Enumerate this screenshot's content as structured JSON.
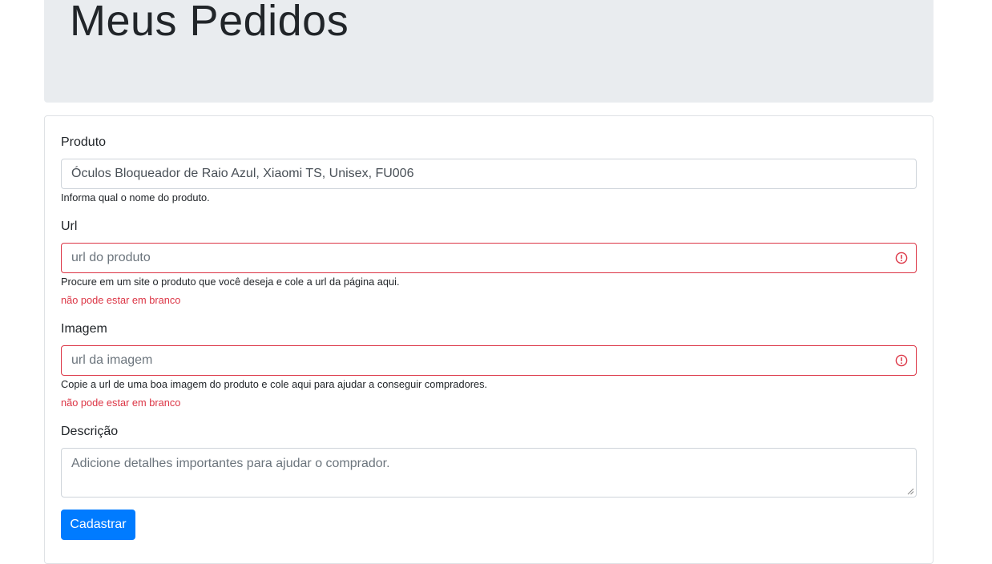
{
  "header": {
    "title": "Meus Pedidos"
  },
  "form": {
    "produto": {
      "label": "Produto",
      "value": "Óculos Bloqueador de Raio Azul, Xiaomi TS, Unisex, FU006",
      "help": "Informa qual o nome do produto."
    },
    "url": {
      "label": "Url",
      "placeholder": "url do produto",
      "help": "Procure em um site o produto que você deseja e cole a url da página aqui.",
      "error": "não pode estar em branco"
    },
    "imagem": {
      "label": "Imagem",
      "placeholder": "url da imagem",
      "help": "Copie a url de uma boa imagem do produto e cole aqui para ajudar a conseguir compradores.",
      "error": "não pode estar em branco"
    },
    "descricao": {
      "label": "Descrição",
      "placeholder": "Adicione detalhes importantes para ajudar o comprador."
    },
    "submit_label": "Cadastrar"
  },
  "colors": {
    "error": "#dc3545",
    "primary": "#007bff",
    "jumbotron_bg": "#e9ecef"
  },
  "icons": {
    "invalid_field": "exclamation-circle-icon",
    "textarea_resize": "resize-handle-icon"
  }
}
